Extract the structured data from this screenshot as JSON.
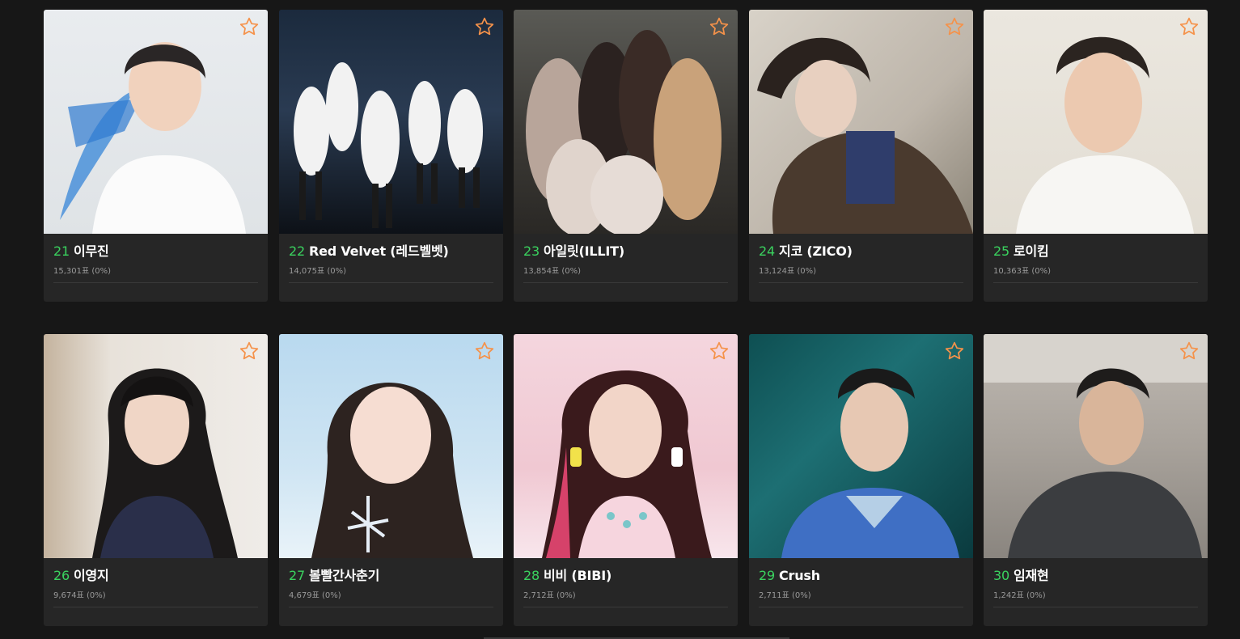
{
  "colors": {
    "background": "#171717",
    "card": "#262626",
    "rank": "#3ad35f",
    "star": "#f5924a",
    "title": "#ffffff",
    "votes": "#9a9a9a"
  },
  "artists": [
    {
      "rank": "21",
      "name": "이무진",
      "votes": "15,301표 (0%)",
      "icon": "star-icon"
    },
    {
      "rank": "22",
      "name": "Red Velvet (레드벨벳)",
      "votes": "14,075표 (0%)",
      "icon": "star-icon"
    },
    {
      "rank": "23",
      "name": "아일릿(ILLIT)",
      "votes": "13,854표 (0%)",
      "icon": "star-icon"
    },
    {
      "rank": "24",
      "name": "지코 (ZICO)",
      "votes": "13,124표 (0%)",
      "icon": "star-icon"
    },
    {
      "rank": "25",
      "name": "로이킴",
      "votes": "10,363표 (0%)",
      "icon": "star-icon"
    },
    {
      "rank": "26",
      "name": "이영지",
      "votes": "9,674표 (0%)",
      "icon": "star-icon"
    },
    {
      "rank": "27",
      "name": "볼빨간사춘기",
      "votes": "4,679표 (0%)",
      "icon": "star-icon"
    },
    {
      "rank": "28",
      "name": "비비 (BIBI)",
      "votes": "2,712표 (0%)",
      "icon": "star-icon"
    },
    {
      "rank": "29",
      "name": "Crush",
      "votes": "2,711표 (0%)",
      "icon": "star-icon"
    },
    {
      "rank": "30",
      "name": "임재현",
      "votes": "1,242표 (0%)",
      "icon": "star-icon"
    }
  ]
}
